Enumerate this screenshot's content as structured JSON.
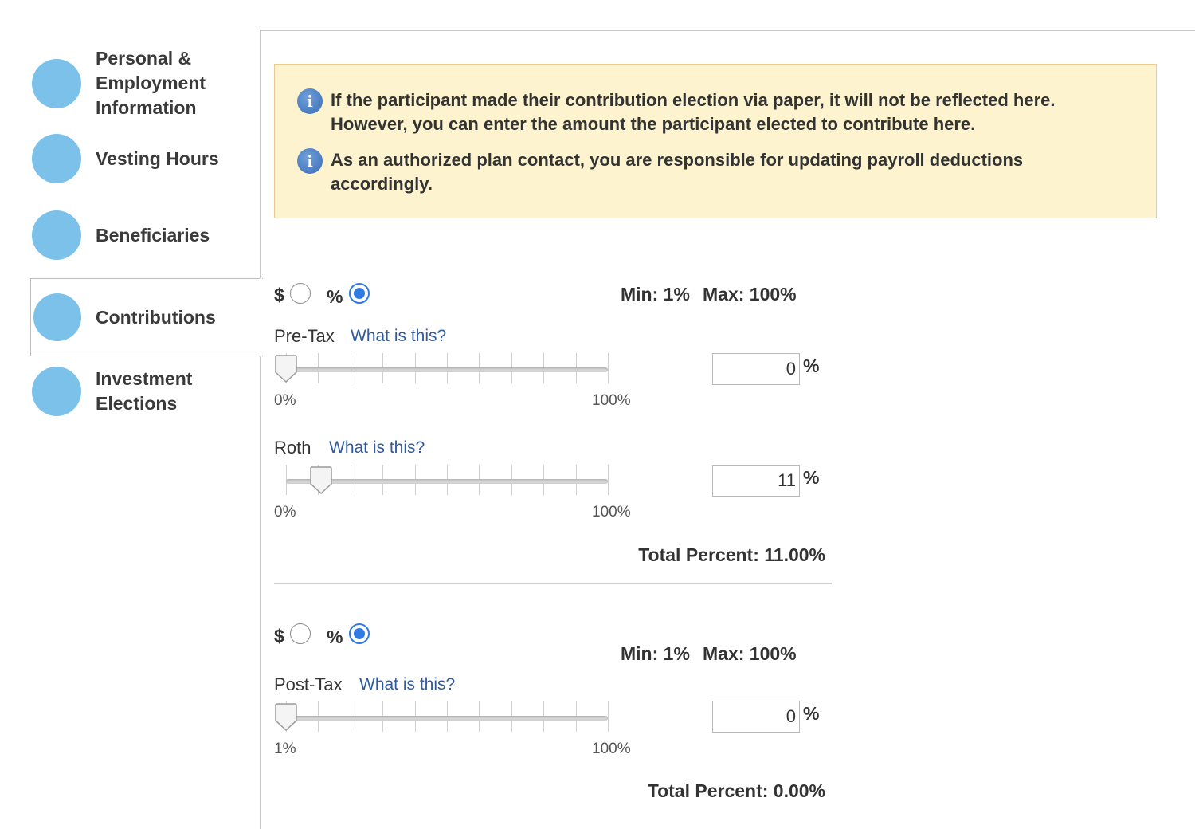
{
  "sidebar": {
    "steps": [
      {
        "label": "Personal & Employment Information"
      },
      {
        "label": "Vesting Hours"
      },
      {
        "label": "Beneficiaries"
      },
      {
        "label": "Contributions"
      },
      {
        "label": "Investment Elections"
      }
    ]
  },
  "notice": {
    "messages": [
      "If the participant made their contribution election via paper, it will not be reflected here. However, you can enter the amount the participant elected to contribute here.",
      "As an authorized plan contact, you are responsible for updating payroll deductions accordingly."
    ]
  },
  "section1": {
    "dollar_label": "$",
    "percent_label": "%",
    "selected_mode": "percent",
    "min_label": "Min: 1%",
    "max_label": "Max: 100%",
    "rows": [
      {
        "label": "Pre-Tax",
        "help": "What is this?",
        "value": "0",
        "level_percent": 0,
        "scale_min": "0%",
        "scale_max": "100%"
      },
      {
        "label": "Roth",
        "help": "What is this?",
        "value": "11",
        "level_percent": 11,
        "scale_min": "0%",
        "scale_max": "100%"
      }
    ],
    "unit": "%",
    "total": "Total Percent: 11.00%"
  },
  "section2": {
    "dollar_label": "$",
    "percent_label": "%",
    "selected_mode": "percent",
    "min_label": "Min: 1%",
    "max_label": "Max: 100%",
    "rows": [
      {
        "label": "Post-Tax",
        "help": "What is this?",
        "value": "0",
        "level_percent": 0,
        "scale_min": "1%",
        "scale_max": "100%"
      }
    ],
    "unit": "%",
    "total": "Total Percent: 0.00%"
  },
  "colors": {
    "step_dot": "#7cc1ea",
    "notice_bg": "#fdf4cf",
    "link": "#2f5b9e",
    "radio_selected": "#2f7ae5"
  }
}
